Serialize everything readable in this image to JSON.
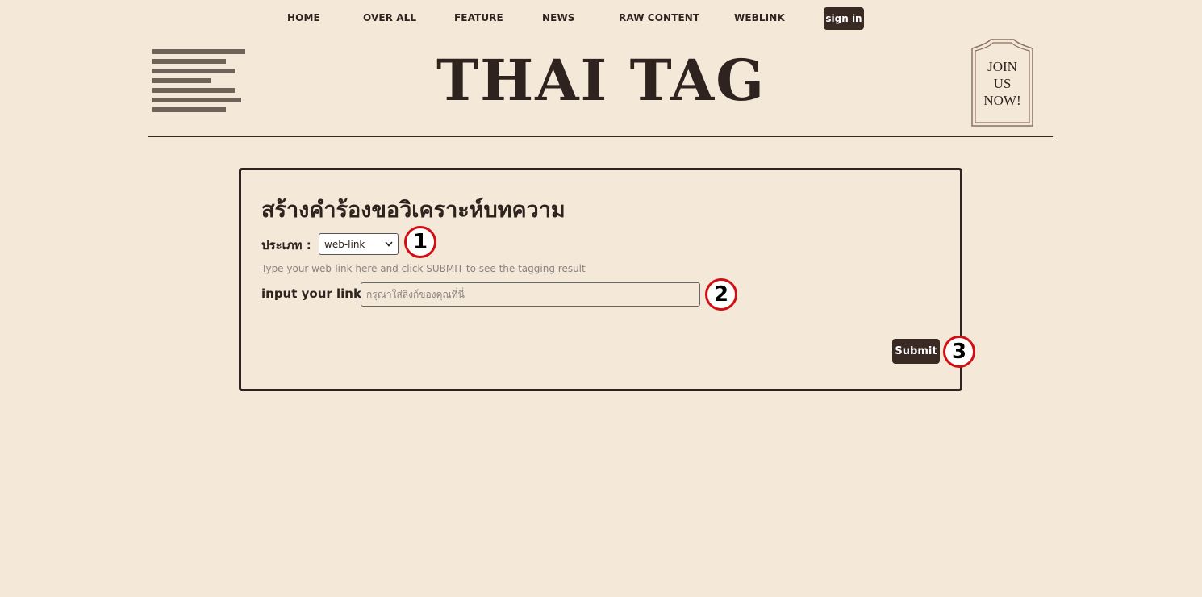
{
  "nav": {
    "items": [
      "HOME",
      "OVER ALL",
      "FEATURE",
      "NEWS",
      "RAW CONTENT",
      "WEBLINK"
    ],
    "signin_label": "sign in"
  },
  "header": {
    "logo_text": "THAI TAG",
    "join_text": "JOIN\nUS\nNOW!"
  },
  "form": {
    "title": "สร้างคำร้องขอวิเคราะห์บทความ",
    "type_label": "ประเภท :",
    "type_selected": "web-link",
    "hint": "Type your web-link here and click SUBMIT to see the tagging result",
    "link_label": "input your link :",
    "link_placeholder": "กรุณาใส่ลิงก์ของคุณที่นี่",
    "link_value": "",
    "submit_label": "Submit"
  },
  "markers": [
    "1",
    "2",
    "3"
  ],
  "colors": {
    "background": "#f4e8d8",
    "dark": "#2e231e",
    "button": "#3a2a24",
    "marker_ring": "#d10f12"
  }
}
